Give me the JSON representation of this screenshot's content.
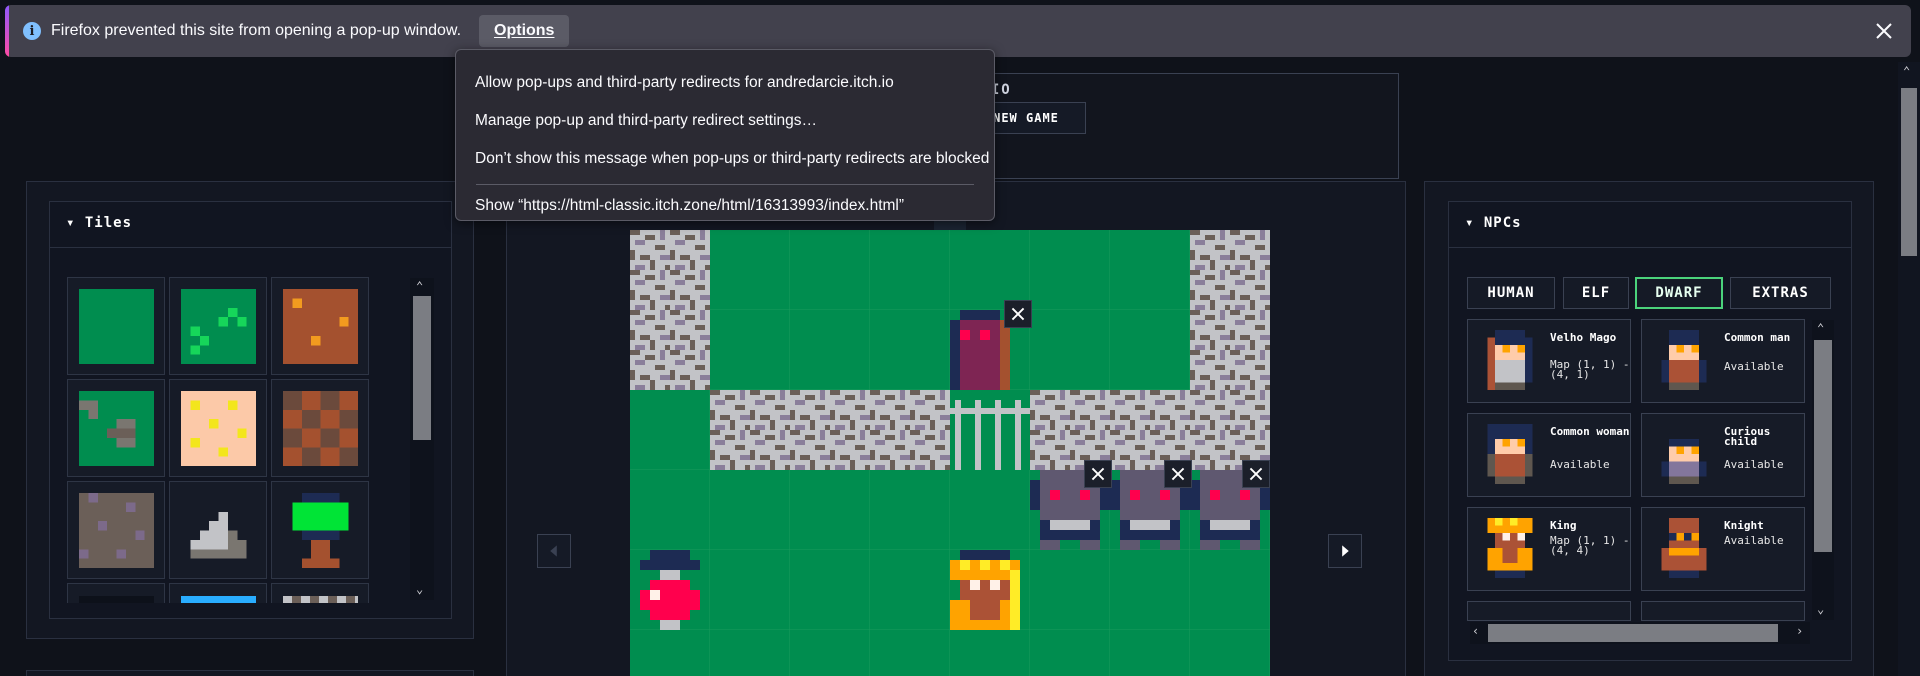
{
  "notification": {
    "text": "Firefox prevented this site from opening a pop-up window.",
    "options_label": "Options"
  },
  "popup_menu": {
    "items": [
      "Allow pop-ups and third-party redirects for andredarcie.itch.io",
      "Manage pop-up and third-party redirect settings…",
      "Don’t show this message when pop-ups or third-party redirects are blocked"
    ],
    "show_label": "Show “https://html-classic.itch.zone/html/16313993/index.html”"
  },
  "header": {
    "studio_fragment": "UDIO",
    "new_game_label": "NEW GAME"
  },
  "tiles_panel": {
    "title": "▾ Tiles"
  },
  "npcs_panel": {
    "title": "▾ NPCs",
    "tabs": [
      "HUMAN",
      "ELF",
      "DWARF",
      "EXTRAS"
    ],
    "active_tab": "DWARF",
    "cards": [
      {
        "name": "Velho Mago",
        "status": "Map (1, 1) - (4, 1)"
      },
      {
        "name": "Common man",
        "status": "Available"
      },
      {
        "name": "Common woman",
        "status": "Available"
      },
      {
        "name": "Curious child",
        "status": "Available"
      },
      {
        "name": "King",
        "status": "Map (1, 1) - (4, 4)"
      },
      {
        "name": "Knight",
        "status": "Available"
      }
    ]
  },
  "colors": {
    "grass": "#008d4f",
    "accent_green": "#4bd37b",
    "firefox_bar": "#42414d"
  }
}
